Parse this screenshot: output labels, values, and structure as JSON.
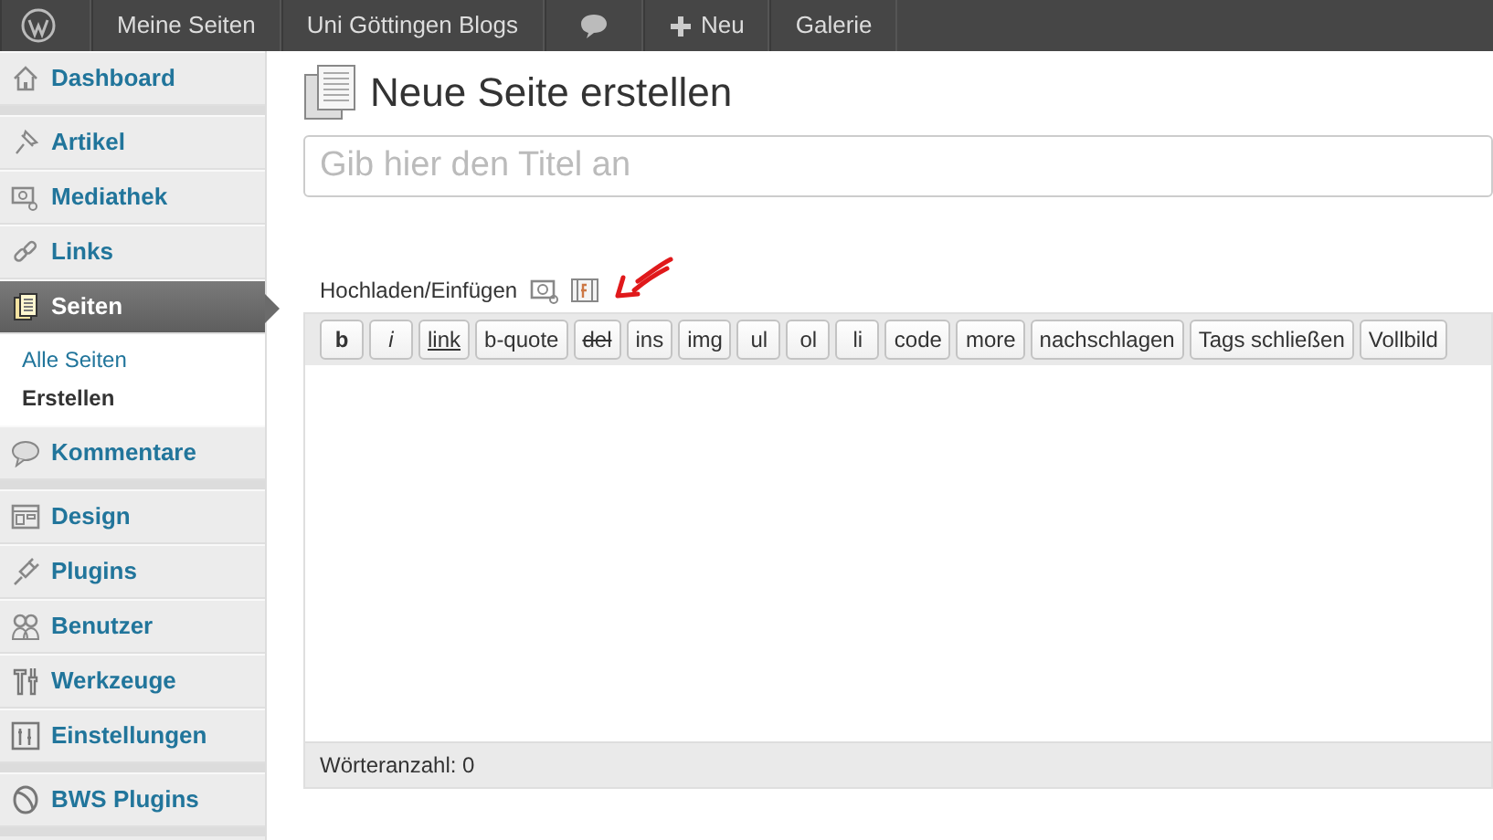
{
  "admin_bar": {
    "items": [
      {
        "kind": "logo"
      },
      {
        "kind": "text",
        "label": "Meine Seiten"
      },
      {
        "kind": "text",
        "label": "Uni Göttingen Blogs"
      },
      {
        "kind": "comments"
      },
      {
        "kind": "new",
        "label": "Neu"
      },
      {
        "kind": "text",
        "label": "Galerie"
      }
    ]
  },
  "sidebar": {
    "groups": [
      [
        {
          "label": "Dashboard",
          "selected": false
        }
      ],
      [
        {
          "label": "Artikel",
          "selected": false
        },
        {
          "label": "Mediathek",
          "selected": false
        },
        {
          "label": "Links",
          "selected": false
        },
        {
          "label": "Seiten",
          "selected": true,
          "children": [
            {
              "label": "Alle Seiten",
              "selected": false
            },
            {
              "label": "Erstellen",
              "selected": true
            }
          ]
        },
        {
          "label": "Kommentare",
          "selected": false
        }
      ],
      [
        {
          "label": "Design",
          "selected": false
        },
        {
          "label": "Plugins",
          "selected": false
        },
        {
          "label": "Benutzer",
          "selected": false
        },
        {
          "label": "Werkzeuge",
          "selected": false
        },
        {
          "label": "Einstellungen",
          "selected": false
        }
      ],
      [
        {
          "label": "BWS Plugins",
          "selected": false
        }
      ]
    ]
  },
  "page": {
    "title": "Neue Seite erstellen",
    "title_field": {
      "placeholder": "Gib hier den Titel an"
    },
    "upload": {
      "label": "Hochladen/Einfügen"
    },
    "toolbar": [
      {
        "label": "b",
        "kind": "bold"
      },
      {
        "label": "i",
        "kind": "italic"
      },
      {
        "label": "link",
        "kind": "underline"
      },
      {
        "label": "b-quote",
        "kind": "plain"
      },
      {
        "label": "del",
        "kind": "strike"
      },
      {
        "label": "ins",
        "kind": "plain"
      },
      {
        "label": "img",
        "kind": "plain"
      },
      {
        "label": "ul",
        "kind": "plain"
      },
      {
        "label": "ol",
        "kind": "plain"
      },
      {
        "label": "li",
        "kind": "plain"
      },
      {
        "label": "code",
        "kind": "plain"
      },
      {
        "label": "more",
        "kind": "plain"
      },
      {
        "label": "nachschlagen",
        "kind": "plain"
      },
      {
        "label": "Tags schließen",
        "kind": "plain"
      },
      {
        "label": "Vollbild",
        "kind": "plain"
      }
    ],
    "word_count": "Wörteranzahl: 0"
  }
}
